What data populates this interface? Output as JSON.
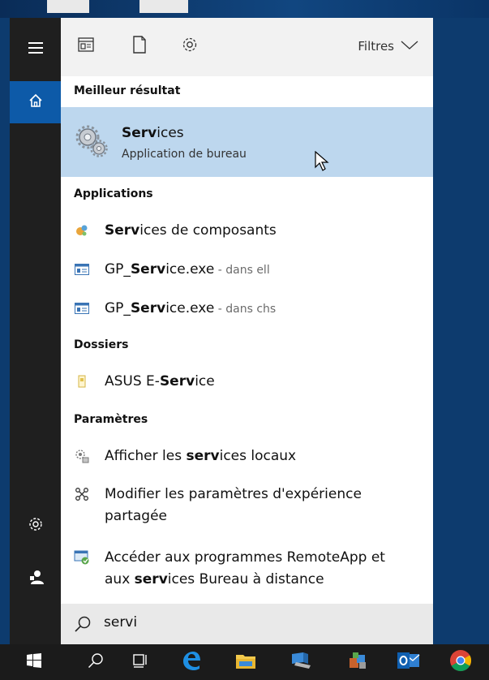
{
  "filters": {
    "label": "Filtres"
  },
  "sections": {
    "best": "Meilleur résultat",
    "apps": "Applications",
    "folders": "Dossiers",
    "settings": "Paramètres"
  },
  "best_result": {
    "title_bold": "Serv",
    "title_rest": "ices",
    "subtitle": "Application de bureau"
  },
  "apps": [
    {
      "bold": "Serv",
      "rest": "ices de composants",
      "suffix": ""
    },
    {
      "pre": "GP_",
      "bold": "Serv",
      "rest": "ice.exe",
      "suffix": " - dans ell"
    },
    {
      "pre": "GP_",
      "bold": "Serv",
      "rest": "ice.exe",
      "suffix": " - dans chs"
    }
  ],
  "folders": [
    {
      "pre": "ASUS E-",
      "bold": "Serv",
      "rest": "ice"
    }
  ],
  "settings": [
    {
      "pre": "Afficher les ",
      "bold": "serv",
      "rest": "ices locaux"
    },
    {
      "line1": "Modifier les paramètres d'expérience",
      "line2": "partagée"
    },
    {
      "line1": "Accéder aux programmes RemoteApp et",
      "line2_pre": "aux ",
      "line2_bold": "serv",
      "line2_rest": "ices Bureau à distance"
    }
  ],
  "search": {
    "value": "servi"
  },
  "icons": {
    "rail": [
      "hamburger-icon",
      "home-icon",
      "gear-icon",
      "user-icon"
    ],
    "topbar": [
      "apps-icon",
      "document-icon",
      "settings-icon"
    ],
    "taskbar": [
      "windows-icon",
      "search-icon",
      "task-view-icon",
      "edge-icon",
      "explorer-icon",
      "app-icon",
      "package-icon",
      "outlook-icon",
      "chrome-icon"
    ]
  },
  "colors": {
    "highlight": "#bdd7ee",
    "rail": "#1f1f1f",
    "rail_active": "#0d5aa8",
    "taskbar": "#1b1b1b"
  }
}
